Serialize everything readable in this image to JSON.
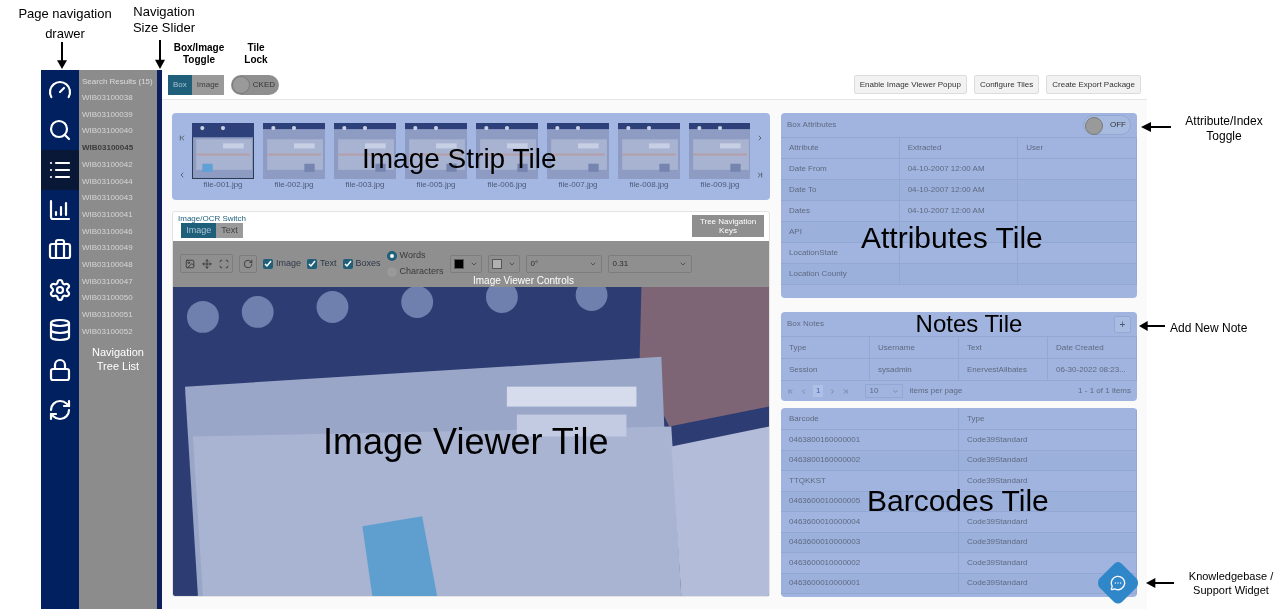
{
  "annotations": [
    "Page navigation drawer",
    "Navigation Size Slider",
    "Box/Image Toggle",
    "Tile Lock",
    "Attribute/Index Toggle",
    "Add New Note",
    "Knowledgebase / Support Widget"
  ],
  "nav_drawer": {
    "items": [
      {
        "selected": false
      },
      {
        "selected": false
      },
      {
        "selected": true
      },
      {
        "selected": false
      },
      {
        "selected": false
      },
      {
        "selected": false
      },
      {
        "selected": false
      },
      {
        "selected": false
      },
      {
        "selected": false
      }
    ]
  },
  "nav_list": {
    "header": "Search Results (15)",
    "overlay_label": "Navigation Tree List",
    "items": [
      {
        "label": "WIB03100038",
        "selected": false
      },
      {
        "label": "WIB03100039",
        "selected": false
      },
      {
        "label": "WIB03100040",
        "selected": false
      },
      {
        "label": "WIB03100045",
        "selected": true
      },
      {
        "label": "WIB03100042",
        "selected": false
      },
      {
        "label": "WIB03100044",
        "selected": false
      },
      {
        "label": "WIB03100043",
        "selected": false
      },
      {
        "label": "WIB03100041",
        "selected": false
      },
      {
        "label": "WIB03100046",
        "selected": false
      },
      {
        "label": "WIB03100049",
        "selected": false
      },
      {
        "label": "WIB03100048",
        "selected": false
      },
      {
        "label": "WIB03100047",
        "selected": false
      },
      {
        "label": "WIB03100050",
        "selected": false
      },
      {
        "label": "WIB03100051",
        "selected": false
      },
      {
        "label": "WIB03100052",
        "selected": false
      }
    ]
  },
  "toolbar": {
    "view_toggle": [
      {
        "label": "Box",
        "selected": true
      },
      {
        "label": "Image",
        "selected": false
      }
    ],
    "tile_lock": {
      "label": "CKED",
      "on": false
    },
    "buttons": [
      "Enable Image Viewer Popup",
      "Configure Tiles",
      "Create Export Package"
    ]
  },
  "image_strip": {
    "overlay_label": "Image Strip Tile",
    "thumbnails": [
      {
        "name": "file-001.jpg",
        "selected": true
      },
      {
        "name": "file-002.jpg",
        "selected": false
      },
      {
        "name": "file-003.jpg",
        "selected": false
      },
      {
        "name": "file-005.jpg",
        "selected": false
      },
      {
        "name": "file-006.jpg",
        "selected": false
      },
      {
        "name": "file-007.jpg",
        "selected": false
      },
      {
        "name": "file-008.jpg",
        "selected": false
      },
      {
        "name": "file-009.jpg",
        "selected": false
      }
    ]
  },
  "viewer": {
    "overlay_label": "Image Viewer Tile",
    "mode_toggle": [
      {
        "label": "Image",
        "selected": true
      },
      {
        "label": "Text",
        "selected": false
      }
    ],
    "switch_label": "Image/OCR Switch",
    "keys_label": "Tree Navigation Keys",
    "controls": {
      "overlay_label": "Image Viewer Controls",
      "checkboxes": [
        {
          "label": "Image",
          "checked": true
        },
        {
          "label": "Text",
          "checked": true
        },
        {
          "label": "Boxes",
          "checked": true
        }
      ],
      "radios": [
        {
          "label": "Words",
          "selected": true
        },
        {
          "label": "Characters",
          "selected": false
        }
      ],
      "swatches": [
        {
          "color": "#000000"
        },
        {
          "color": "#b0b0b0"
        }
      ],
      "rotation": "0°",
      "zoom": "0.31"
    }
  },
  "attributes": {
    "title": "Box Attributes",
    "overlay_label": "Attributes Tile",
    "toggle": {
      "label": "OFF",
      "on": false
    },
    "columns": [
      "Attribute",
      "Extracted",
      "User"
    ],
    "rows": [
      {
        "attribute": "Date From",
        "extracted": "04-10-2007 12:00 AM"
      },
      {
        "attribute": "Date To",
        "extracted": "04-10-2007 12:00 AM"
      },
      {
        "attribute": "Dates",
        "extracted": "04-10-2007 12:00 AM"
      },
      {
        "attribute": "API"
      },
      {
        "attribute": "LocationState"
      },
      {
        "attribute": "Location County"
      }
    ]
  },
  "notes": {
    "title": "Box Notes",
    "overlay_label": "Notes Tile",
    "add_label": "+",
    "columns": [
      "Type",
      "Username",
      "Text",
      "Date Created"
    ],
    "rows": [
      [
        "Session",
        "sysadmin",
        "EnervestAllbates",
        "06-30-2022 08:23..."
      ]
    ],
    "pager": {
      "pages": [
        {
          "label": "1",
          "selected": true
        }
      ],
      "page_size": "10",
      "page_size_label": "items per page",
      "summary": "1 - 1 of 1 items"
    }
  },
  "barcodes": {
    "overlay_label": "Barcodes Tile",
    "columns": [
      "Barcode",
      "Type"
    ],
    "rows": [
      [
        "0463800160000001",
        "Code39Standard"
      ],
      [
        "0463800160000002",
        "Code39Standard"
      ],
      [
        "TTQKKST",
        "Code39Standard"
      ],
      [
        "0463600010000005"
      ],
      [
        "0463600010000004",
        "Code39Standard"
      ],
      [
        "0463600010000003",
        "Code39Standard"
      ],
      [
        "0463600010000002",
        "Code39Standard"
      ],
      [
        "0463600010000001",
        "Code39Standard"
      ]
    ]
  }
}
